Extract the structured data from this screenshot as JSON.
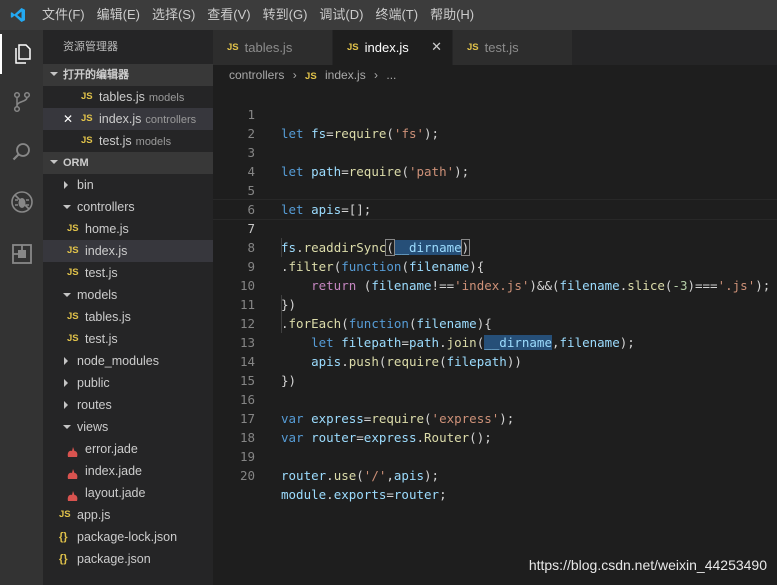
{
  "menu": [
    "文件(F)",
    "编辑(E)",
    "选择(S)",
    "查看(V)",
    "转到(G)",
    "调试(D)",
    "终端(T)",
    "帮助(H)"
  ],
  "sidebar": {
    "title": "资源管理器",
    "open_editors_header": "打开的编辑器",
    "open_editors": [
      {
        "badge": "JS",
        "name": "tables.js",
        "dir": "models"
      },
      {
        "badge": "JS",
        "name": "index.js",
        "dir": "controllers",
        "close": "✕"
      },
      {
        "badge": "JS",
        "name": "test.js",
        "dir": "models"
      }
    ],
    "project_header": "ORM",
    "tree": {
      "bin": "bin",
      "controllers": "controllers",
      "controllers_files": [
        "home.js",
        "index.js",
        "test.js"
      ],
      "models": "models",
      "models_files": [
        "tables.js",
        "test.js"
      ],
      "node_modules": "node_modules",
      "public": "public",
      "routes": "routes",
      "views": "views",
      "views_files": [
        "error.jade",
        "index.jade",
        "layout.jade"
      ],
      "app": "app.js",
      "package_lock": "package-lock.json",
      "package": "package.json"
    },
    "js_badge": "JS",
    "json_badge": "{}"
  },
  "tabs": [
    {
      "badge": "JS",
      "label": "tables.js"
    },
    {
      "badge": "JS",
      "label": "index.js",
      "close": "✕"
    },
    {
      "badge": "JS",
      "label": "test.js"
    }
  ],
  "breadcrumb": {
    "folder": "controllers",
    "sep": "›",
    "badge": "JS",
    "file": "index.js",
    "more": "..."
  },
  "editor": {
    "line_numbers": [
      "1",
      "2",
      "3",
      "4",
      "5",
      "6",
      "7",
      "8",
      "9",
      "10",
      "11",
      "12",
      "13",
      "14",
      "15",
      "16",
      "17",
      "18",
      "19",
      "20"
    ],
    "lines": {
      "l1": [
        "let",
        " ",
        "fs",
        "=",
        "require",
        "(",
        "'fs'",
        ");"
      ],
      "l3": [
        "let",
        " ",
        "path",
        "=",
        "require",
        "(",
        "'path'",
        ");"
      ],
      "l5": [
        "let",
        " ",
        "apis",
        "=[];"
      ],
      "l7": [
        "fs",
        ".",
        "readdirSync",
        "(",
        "__dirname",
        ")"
      ],
      "l8": [
        ".",
        "filter",
        "(",
        "function",
        "(",
        "filename",
        "){"
      ],
      "l9": [
        "    ",
        "return",
        " (",
        "filename",
        "!==",
        "'index.js'",
        ")&&(",
        "filename",
        ".",
        "slice",
        "(",
        "-3",
        ")===",
        "'.js'",
        ");"
      ],
      "l10": [
        "})"
      ],
      "l11": [
        ".",
        "forEach",
        "(",
        "function",
        "(",
        "filename",
        "){"
      ],
      "l12": [
        "    ",
        "let",
        " ",
        "filepath",
        "=",
        "path",
        ".",
        "join",
        "(",
        "__dirname",
        ",",
        "filename",
        ");"
      ],
      "l13": [
        "    ",
        "apis",
        ".",
        "push",
        "(",
        "require",
        "(",
        "filepath",
        "))"
      ],
      "l14": [
        "})"
      ],
      "l16": [
        "var",
        " ",
        "express",
        "=",
        "require",
        "(",
        "'express'",
        ");"
      ],
      "l17": [
        "var",
        " ",
        "router",
        "=",
        "express",
        ".",
        "Router",
        "();"
      ],
      "l19": [
        "router",
        ".",
        "use",
        "(",
        "'/'",
        ",",
        "apis",
        ");"
      ],
      "l20": [
        "module",
        ".",
        "exports",
        "=",
        "router",
        ";"
      ]
    }
  },
  "watermark": "https://blog.csdn.net/weixin_44253490",
  "colors": {
    "accent": "#0e639c",
    "js_badge": "#e0c24a",
    "keyword": "#569cd6",
    "string": "#ce9178",
    "function": "#dcdcaa",
    "variable": "#9cdcfe",
    "number": "#b5cea8"
  }
}
